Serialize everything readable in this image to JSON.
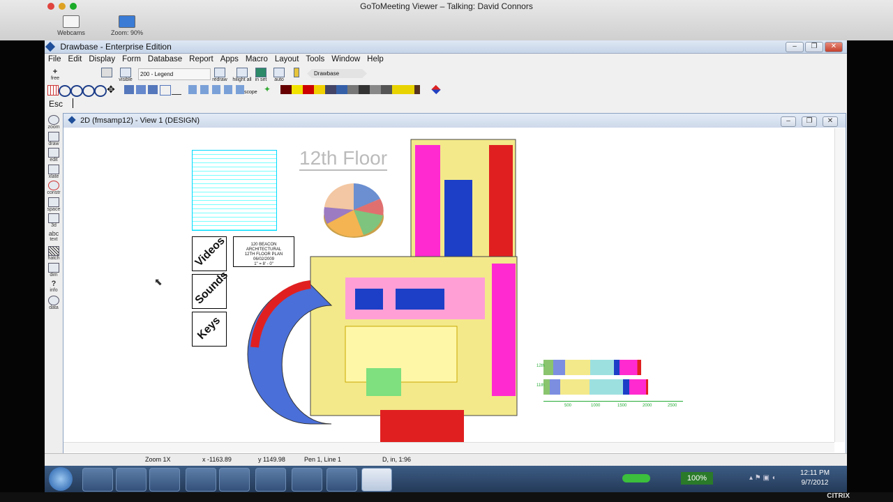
{
  "mac": {
    "title": "GoToMeeting Viewer – Talking: David Connors",
    "tools": [
      {
        "label": "Webcams"
      },
      {
        "label": "Zoom: 90%"
      }
    ]
  },
  "app": {
    "title": "Drawbase - Enterprise Edition",
    "menu": [
      "File",
      "Edit",
      "Display",
      "Form",
      "Database",
      "Report",
      "Apps",
      "Macro",
      "Layout",
      "Tools",
      "Window",
      "Help"
    ],
    "toolbar1": {
      "free_label": "free",
      "visible_label": "visible",
      "layer_select": "200 - Legend",
      "redraw_label": "redraw",
      "hilight_label": "hilight all",
      "inset_label": "in set",
      "auto_label": "auto",
      "breadcrumb": "Drawbase"
    },
    "scope_label": "scope",
    "command": {
      "prefix": "Esc",
      "value": ""
    },
    "left_tools": [
      "zoom",
      "draw",
      "edit",
      "xlate",
      "constr",
      "space",
      "3d",
      "text",
      "hatch",
      "dim",
      "info",
      "data"
    ],
    "inner_title": "2D (fmsamp12) - View 1 (DESIGN)",
    "status": {
      "zoom": "Zoom 1X",
      "x": "x -1163.89",
      "y": "y 1149.98",
      "pen": "Pen 1,  Line 1",
      "units": "D, in, 1:96"
    }
  },
  "drawing": {
    "floor_title": "12th Floor",
    "buttons": [
      "Videos",
      "Sounds",
      "Keys"
    ],
    "title_block": [
      "120 BEACON",
      "ARCHITECTURAL",
      "12TH FLOOR PLAN",
      "06/02/2009",
      "1\" = 8' - 0\""
    ],
    "bar_axis": [
      "500",
      "1000",
      "1500",
      "2000",
      "2500"
    ],
    "bar_rows": [
      "12th",
      "11th"
    ]
  },
  "taskbar": {
    "battery": "100%",
    "time": "12:11 PM",
    "date": "9/7/2012",
    "brand": "CITRIX"
  },
  "colors": {
    "accent": "#1f4f9a",
    "blue": "#1d3fc7",
    "red": "#e02020",
    "magenta": "#ff2bd0",
    "yellow": "#f3e98a",
    "cyan": "#00e5ff"
  }
}
